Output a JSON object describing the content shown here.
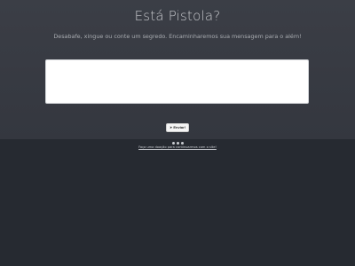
{
  "header": {
    "title": "Está Pistola?",
    "subtitle": "Desabafe, xingue ou conte um segredo. Encaminharemos sua mensagem para o além!"
  },
  "form": {
    "message_value": "",
    "send_label": "Enviar!",
    "send_icon": "paper-plane-icon"
  },
  "footer": {
    "social_icons": [
      "facebook-icon",
      "twitter-icon",
      "github-icon"
    ],
    "link_text": "Faça uma doação para continuarmos com o site!"
  },
  "colors": {
    "hero_bg": "#3b3e46",
    "footer_bg": "#262a31",
    "title_text": "#c6c8cc",
    "subtitle_text": "#a9acb1"
  }
}
